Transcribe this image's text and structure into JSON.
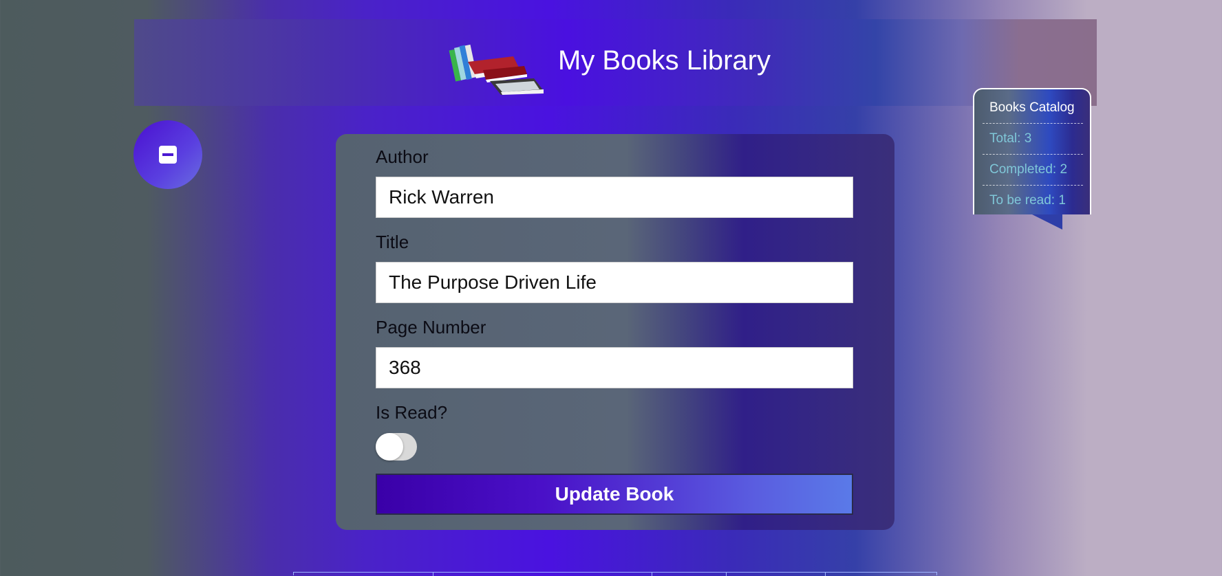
{
  "app": {
    "title": "My Books Library",
    "logo_icon": "books-stack-icon"
  },
  "sidebar_toggle": {
    "icon": "minus-square-icon"
  },
  "form": {
    "author": {
      "label": "Author",
      "value": "Rick Warren"
    },
    "title": {
      "label": "Title",
      "value": "The Purpose Driven Life"
    },
    "pages": {
      "label": "Page Number",
      "value": "368"
    },
    "is_read": {
      "label": "Is Read?",
      "checked": false
    },
    "submit_label": "Update Book"
  },
  "catalog": {
    "heading": "Books Catalog",
    "total": "Total: 3",
    "completed": "Completed: 2",
    "to_be_read": "To be read: 1"
  },
  "colors": {
    "accent": "#4a10e0",
    "button_gradient_start": "#3a00a8",
    "button_gradient_end": "#5a7ae8",
    "stat_text": "#7fc7d8"
  }
}
